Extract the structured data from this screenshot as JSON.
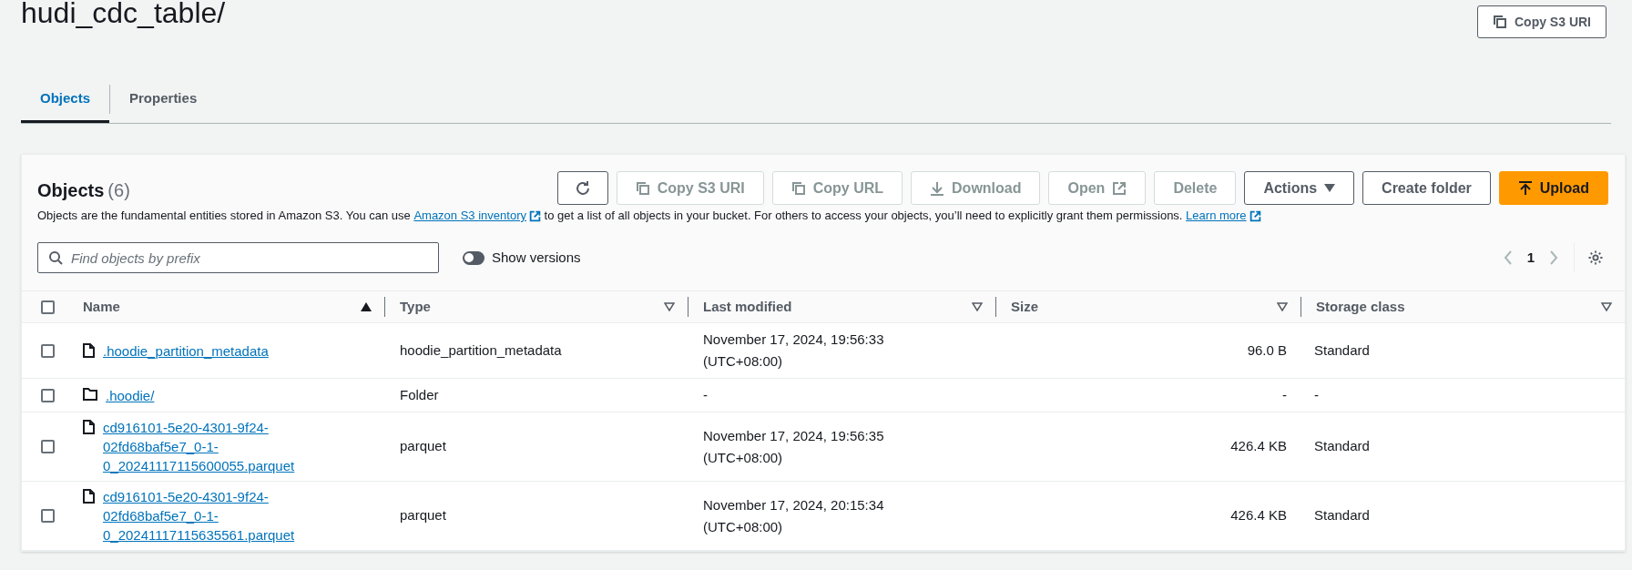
{
  "header": {
    "title": "hudi_cdc_table/",
    "copy_button": "Copy S3 URI"
  },
  "tabs": [
    {
      "label": "Objects",
      "selected": true
    },
    {
      "label": "Properties",
      "selected": false
    }
  ],
  "objects_panel": {
    "title": "Objects",
    "count": "(6)",
    "actions": [
      {
        "kind": "refresh",
        "disabled": false
      },
      {
        "kind": "copy",
        "label": "Copy S3 URI",
        "disabled": true
      },
      {
        "kind": "copy",
        "label": "Copy URL",
        "disabled": true
      },
      {
        "kind": "download",
        "label": "Download",
        "disabled": true
      },
      {
        "kind": "external",
        "label": "Open",
        "disabled": true
      },
      {
        "kind": "plain",
        "label": "Delete",
        "disabled": true
      },
      {
        "kind": "dropdown",
        "label": "Actions",
        "disabled": false
      },
      {
        "kind": "plain",
        "label": "Create folder",
        "disabled": false
      },
      {
        "kind": "upload",
        "label": "Upload",
        "disabled": false
      }
    ],
    "description": [
      {
        "kind": "text",
        "text": "Objects are the fundamental entities stored in Amazon S3. You can use"
      },
      {
        "kind": "link",
        "text": "Amazon S3 inventory"
      },
      {
        "kind": "text",
        "text": "to get a list of all objects in your bucket. For others to access your objects, you’ll need to explicitly grant them permissions."
      },
      {
        "kind": "link",
        "text": "Learn more"
      }
    ],
    "search": {
      "placeholder": "Find objects by prefix"
    },
    "versions_toggle": {
      "label": "Show versions",
      "on": false
    },
    "pagination": {
      "page": "1"
    },
    "table": {
      "select_all_checked": false,
      "columns": [
        {
          "label": "Name",
          "sorted": true
        },
        {
          "label": "Type",
          "sorted": false
        },
        {
          "label": "Last modified",
          "sorted": false
        },
        {
          "label": "Size",
          "sorted": false
        },
        {
          "label": "Storage class",
          "sorted": false
        }
      ],
      "rows": [
        {
          "kind": "file",
          "checked": false,
          "name": ".hoodie_partition_metadata",
          "type": "hoodie_partition_metadata",
          "last_modified": "November 17, 2024, 19:56:33 (UTC+08:00)",
          "size": "96.0 B",
          "storage_class": "Standard"
        },
        {
          "kind": "folder",
          "checked": false,
          "name": ".hoodie/",
          "type": "Folder",
          "last_modified": "-",
          "size": "-",
          "storage_class": "-"
        },
        {
          "kind": "file",
          "checked": false,
          "name": "cd916101-5e20-4301-9f24-02fd68baf5e7_0-1-0_20241117115600055.parquet",
          "type": "parquet",
          "last_modified": "November 17, 2024, 19:56:35 (UTC+08:00)",
          "size": "426.4 KB",
          "storage_class": "Standard"
        },
        {
          "kind": "file",
          "checked": false,
          "name": "cd916101-5e20-4301-9f24-02fd68baf5e7_0-1-0_20241117115635561.parquet",
          "type": "parquet",
          "last_modified": "November 17, 2024, 20:15:34 (UTC+08:00)",
          "size": "426.4 KB",
          "storage_class": "Standard"
        }
      ]
    }
  }
}
